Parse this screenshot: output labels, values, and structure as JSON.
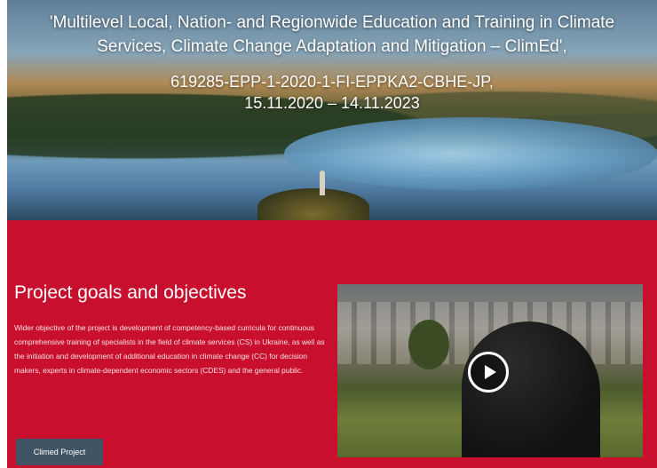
{
  "hero": {
    "title": "'Multilevel Local, Nation- and Regionwide Education and Training in Climate Services, Climate Change Adaptation and Mitigation – ClimEd',",
    "project_code": "619285-EPP-1-2020-1-FI-EPPKA2-CBHE-JP,",
    "dates": "15.11.2020 – 14.11.2023"
  },
  "goals": {
    "heading": "Project goals and objectives",
    "body": "Wider objective of the project is development of competency-based curricula for continuous comprehensive training of specialists in the field of climate services (CS) in Ukraine, as well as the initiation and development of additional education in climate change (CC) for decision makers, experts in climate-dependent economic sectors (CDES) and the general public.",
    "button_label": "Climed Project"
  },
  "video": {
    "play_icon": "play-icon"
  },
  "colors": {
    "accent_red": "#c8102e",
    "button_bg": "#3f5565"
  }
}
